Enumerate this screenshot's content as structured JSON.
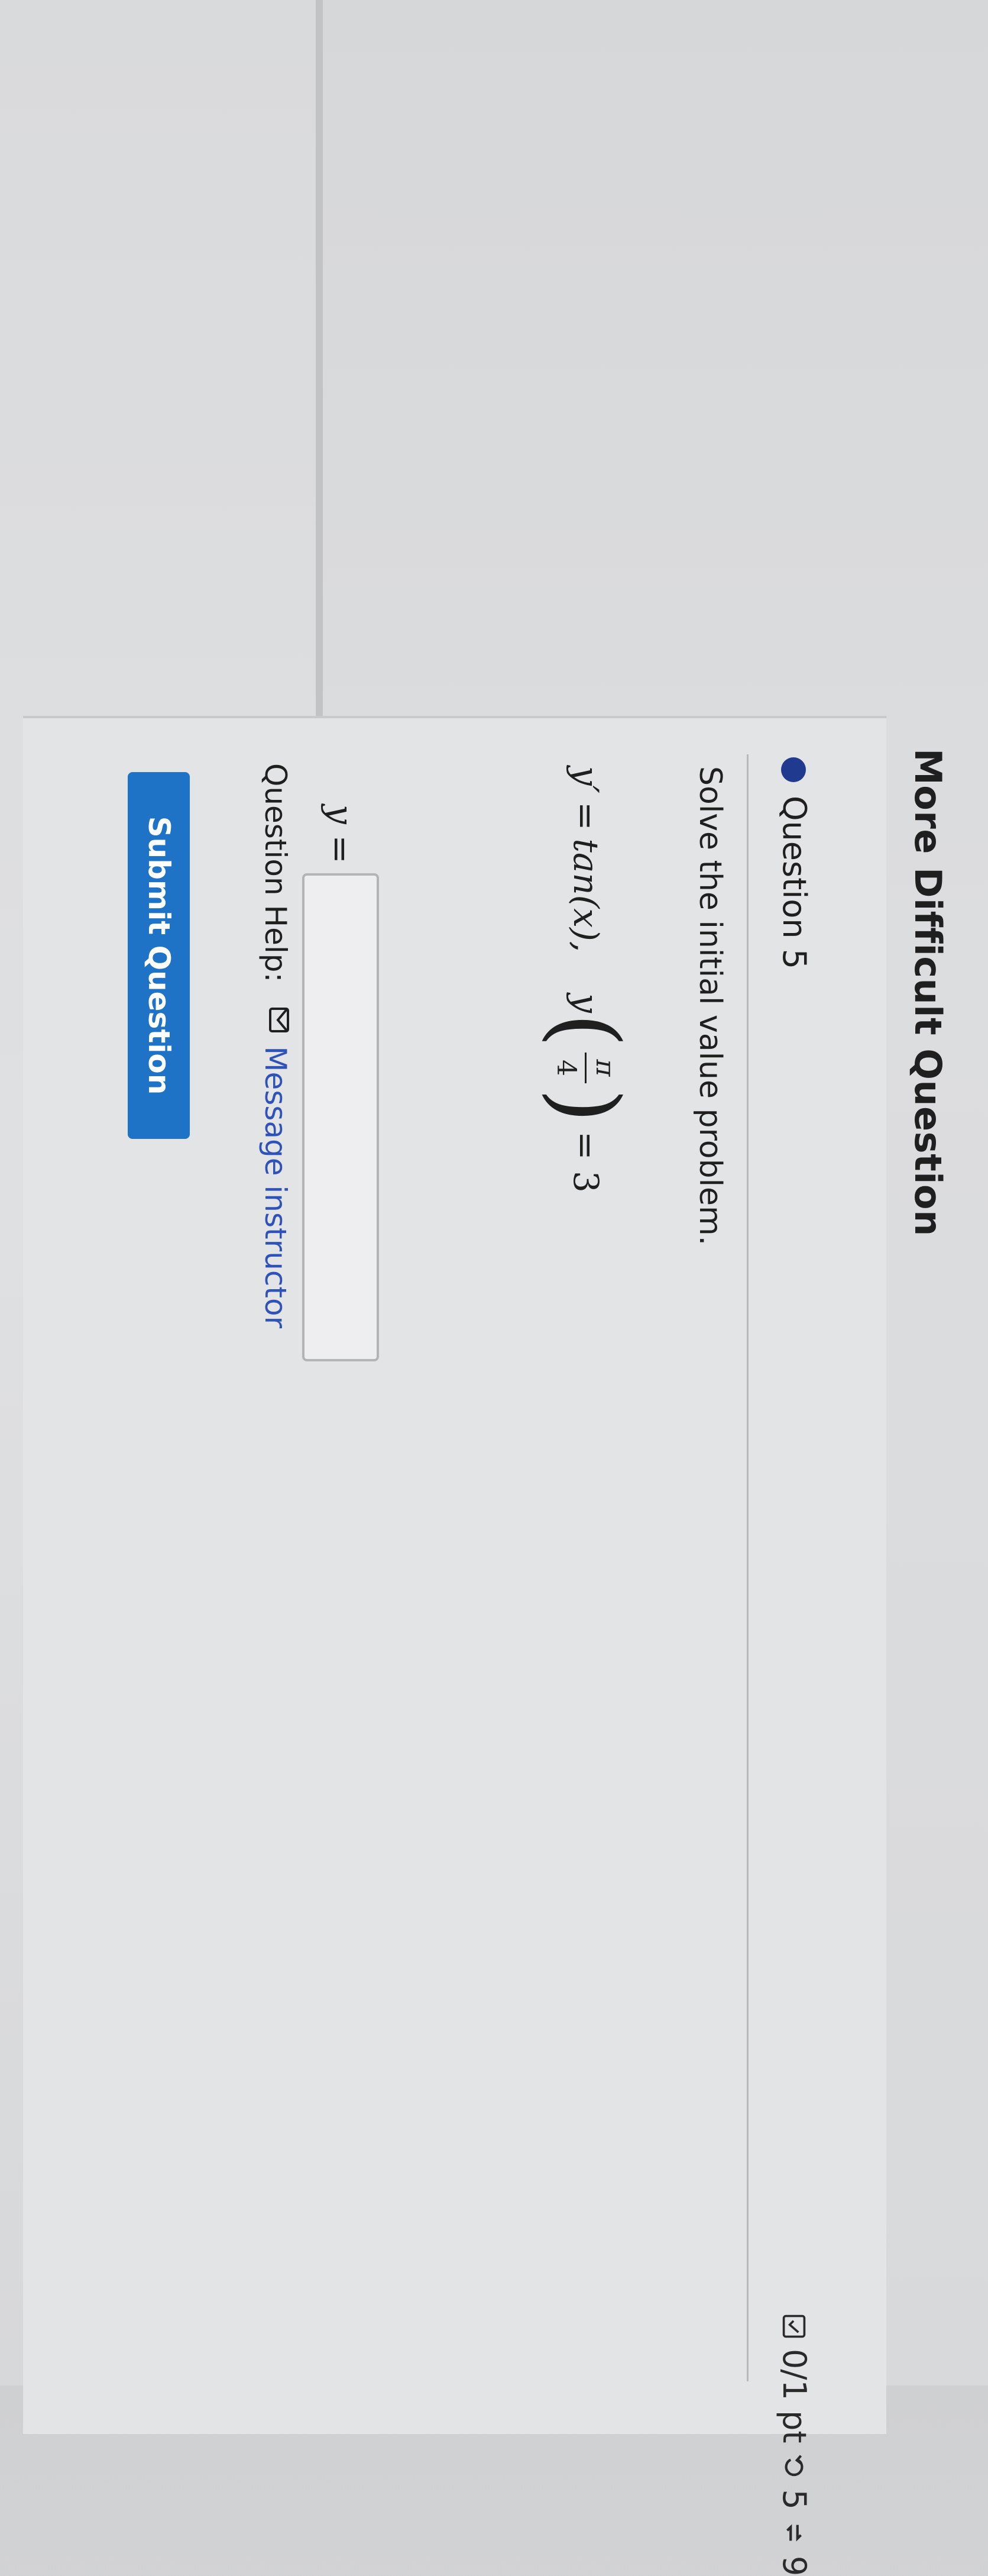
{
  "section": {
    "title": "More Difficult Question"
  },
  "question": {
    "label": "Question 5",
    "score": "0/1 pt",
    "retries": "5",
    "attempts": "9",
    "prompt": "Solve the initial value problem.",
    "equation": {
      "lhs": "y′",
      "eq": "=",
      "rhs": "tan(x),",
      "cond_fn": "y",
      "cond_num": "π",
      "cond_den": "4",
      "cond_eq": "= 3"
    },
    "answer": {
      "label": "y =",
      "value": ""
    },
    "help": {
      "label": "Question Help:",
      "link_label": "Message instructor"
    },
    "submit_label": "Submit Question"
  },
  "icons": {
    "score": "checkbox-icon",
    "retry": "undo-icon",
    "attempts": "refresh-icon",
    "help": "mail-icon"
  },
  "colors": {
    "accent": "#1e73c6",
    "link": "#2f52b8",
    "dot": "#1f3a8f"
  }
}
